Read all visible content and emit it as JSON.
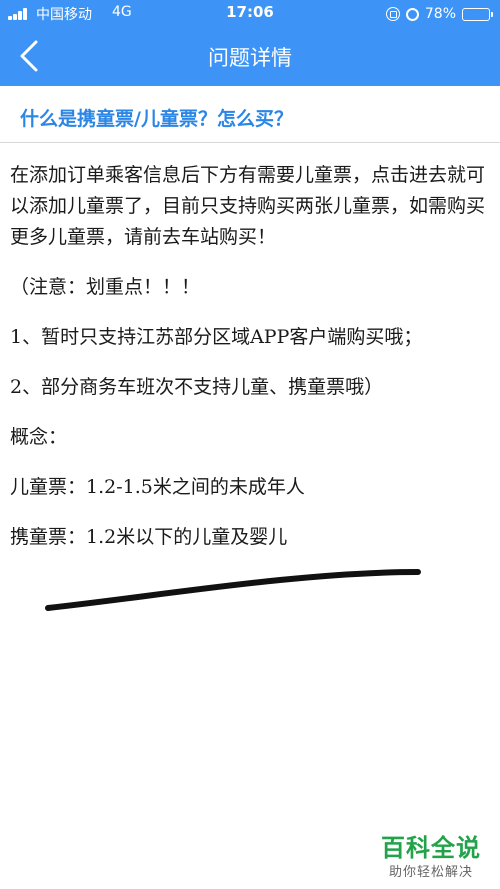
{
  "status_bar": {
    "carrier": "中国移动",
    "network": "4G",
    "time": "17:06",
    "battery": "78%",
    "battery_level": 0.78
  },
  "nav": {
    "title": "问题详情",
    "back_icon": "chevron-left-icon"
  },
  "question": "什么是携童票/儿童票？怎么买？",
  "paragraphs": [
    "在添加订单乘客信息后下方有需要儿童票，点击进去就可以添加儿童票了，目前只支持购买两张儿童票，如需购买更多儿童票，请前去车站购买！",
    "（注意：划重点！！！",
    "1、暂时只支持江苏部分区域APP客户端购买哦；",
    "2、部分商务车班次不支持儿童、携童票哦）",
    "概念：",
    "儿童票：1.2-1.5米之间的未成年人",
    "携童票：1.2米以下的儿童及婴儿"
  ],
  "watermark": {
    "title": "百科全说",
    "subtitle": "助你轻松解决"
  },
  "colors": {
    "nav_bg": "#3d94f6",
    "question_text": "#2b86e6",
    "watermark_green": "#22a34a"
  }
}
